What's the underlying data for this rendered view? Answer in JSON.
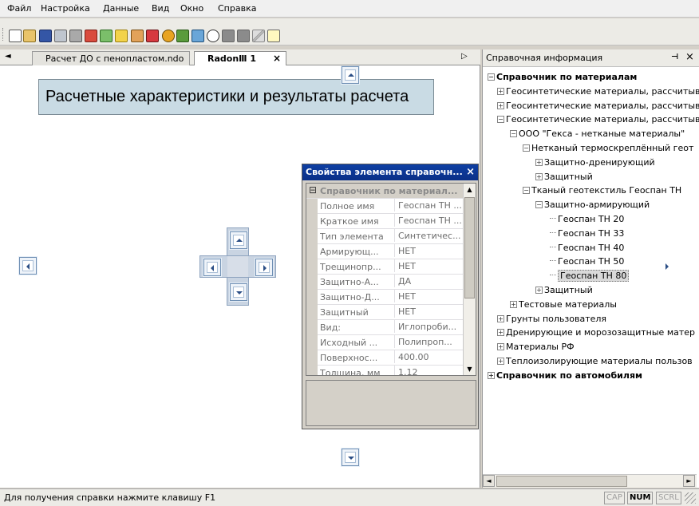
{
  "menu": [
    "Файл",
    "Настройка",
    "Данные",
    "Вид",
    "Окно",
    "Справка"
  ],
  "toolbar_icons": [
    "new-doc-icon",
    "open-folder-icon",
    "save-icon",
    "copy-icon",
    "print-icon",
    "export-icon",
    "calc-icon",
    "wizard-icon",
    "pencil-icon",
    "truck-icon",
    "bomb-icon",
    "layers-icon",
    "calculator-icon",
    "eye-icon",
    "gray-square-icon",
    "gray-square-icon-2",
    "diagonal-lines-icon",
    "help-icon"
  ],
  "tabs": {
    "items": [
      {
        "label": "Расчет ДО с пенопластом.ndo",
        "active": false
      },
      {
        "label": "RadonⅢ 1",
        "active": true
      }
    ],
    "close_glyph": "×",
    "nav_left": "◄",
    "nav_right": "▷"
  },
  "document": {
    "title": "Расчетные характеристики и результаты расчета"
  },
  "properties": {
    "title": "Свойства элемента справочн...",
    "close_glyph": "×",
    "category": "Справочник по материал...",
    "category_glyph": "⊟",
    "rows": [
      {
        "key": "Полное имя",
        "value": "Геоспан ТН ..."
      },
      {
        "key": "Краткое имя",
        "value": "Геоспан ТН ..."
      },
      {
        "key": "Тип элемента",
        "value": "Синтетичес..."
      },
      {
        "key": "Армирующ...",
        "value": "НЕТ"
      },
      {
        "key": "Трещинопр...",
        "value": "НЕТ"
      },
      {
        "key": "Защитно-А...",
        "value": "ДА"
      },
      {
        "key": "Защитно-Д...",
        "value": "НЕТ"
      },
      {
        "key": "Защитный",
        "value": "НЕТ"
      },
      {
        "key": "Вид:",
        "value": "Иглопроби..."
      },
      {
        "key": "Исходный ...",
        "value": "Полипроп..."
      },
      {
        "key": "Поверхнос...",
        "value": "400.00"
      },
      {
        "key": "Толщина, мм",
        "value": "1.12"
      }
    ]
  },
  "reference": {
    "title": "Справочная информация",
    "pin_glyph": "⊣",
    "close_glyph": "×",
    "tree": [
      {
        "label": "Справочник по материалам",
        "level": 0,
        "exp": "−",
        "bold": true
      },
      {
        "label": "Геосинтетические материалы, рассчитыв",
        "level": 1,
        "exp": "+"
      },
      {
        "label": "Геосинтетические материалы, рассчитыв",
        "level": 1,
        "exp": "+"
      },
      {
        "label": "Геосинтетические материалы, рассчитыв",
        "level": 1,
        "exp": "−"
      },
      {
        "label": "ООО \"Гекса - нетканые материалы\"",
        "level": 2,
        "exp": "−"
      },
      {
        "label": "Нетканый термоскреплённый геот",
        "level": 3,
        "exp": "−"
      },
      {
        "label": "Защитно-дренирующий",
        "level": 4,
        "exp": "+"
      },
      {
        "label": "Защитный",
        "level": 4,
        "exp": "+"
      },
      {
        "label": "Тканый геотекстиль Геоспан ТН",
        "level": 3,
        "exp": "−"
      },
      {
        "label": "Защитно-армирующий",
        "level": 4,
        "exp": "−"
      },
      {
        "label": "Геоспан ТН 20",
        "level": 5,
        "exp": ""
      },
      {
        "label": "Геоспан ТН 33",
        "level": 5,
        "exp": ""
      },
      {
        "label": "Геоспан ТН 40",
        "level": 5,
        "exp": ""
      },
      {
        "label": "Геоспан ТН 50",
        "level": 5,
        "exp": ""
      },
      {
        "label": "Геоспан ТН 80",
        "level": 5,
        "exp": "",
        "selected": true
      },
      {
        "label": "Защитный",
        "level": 4,
        "exp": "+"
      },
      {
        "label": "Тестовые материалы",
        "level": 2,
        "exp": "+"
      },
      {
        "label": "Грунты пользователя",
        "level": 1,
        "exp": "+"
      },
      {
        "label": "Дренирующие и морозозащитные матер",
        "level": 1,
        "exp": "+"
      },
      {
        "label": "Материалы РФ",
        "level": 1,
        "exp": "+"
      },
      {
        "label": "Теплоизолирующие материалы пользов",
        "level": 1,
        "exp": "+"
      },
      {
        "label": "Справочник по автомобилям",
        "level": 0,
        "exp": "+",
        "bold": true
      }
    ]
  },
  "status": {
    "text": "Для получения справки нажмите клавишу F1",
    "indicators": [
      {
        "label": "CAP",
        "on": false
      },
      {
        "label": "NUM",
        "on": true
      },
      {
        "label": "SCRL",
        "on": false
      }
    ]
  }
}
